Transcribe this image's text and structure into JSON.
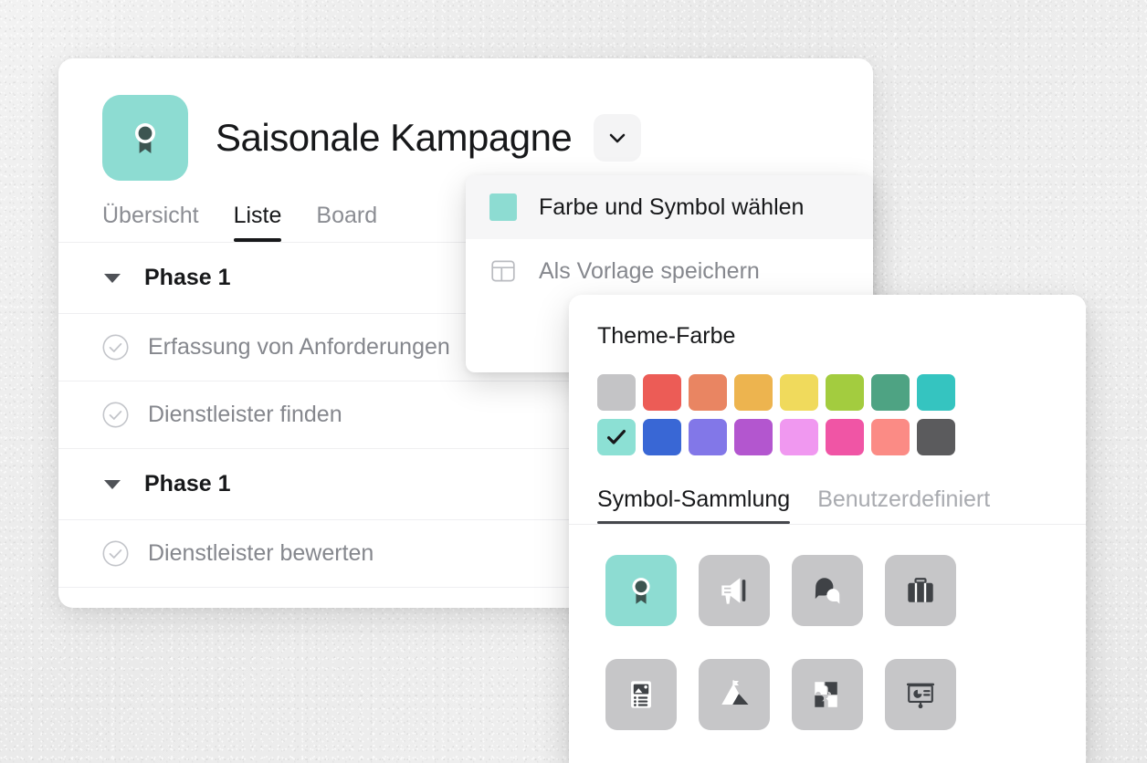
{
  "project": {
    "title": "Saisonale Kampagne",
    "icon": "award-ribbon-icon",
    "icon_color": "#8ddcd2",
    "caret_icon": "chevron-down-icon"
  },
  "tabs": [
    {
      "label": "Übersicht",
      "active": false
    },
    {
      "label": "Liste",
      "active": true
    },
    {
      "label": "Board",
      "active": false
    }
  ],
  "list": [
    {
      "type": "group",
      "label": "Phase 1",
      "caret": "caret-down-icon"
    },
    {
      "type": "task",
      "label": "Erfassung von Anforderungen",
      "check": "check-circle-icon"
    },
    {
      "type": "task",
      "label": "Dienstleister finden",
      "check": "check-circle-icon"
    },
    {
      "type": "group",
      "label": "Phase 1",
      "caret": "caret-down-icon"
    },
    {
      "type": "task",
      "label": "Dienstleister bewerten",
      "check": "check-circle-icon"
    }
  ],
  "context_menu": {
    "items": [
      {
        "label": "Farbe und Symbol wählen",
        "icon": "color-swatch-icon",
        "swatch_color": "#8ddcd2",
        "highlighted": true
      },
      {
        "label": "Als Vorlage speichern",
        "icon": "template-layout-icon",
        "highlighted": false
      }
    ]
  },
  "picker": {
    "theme_color_title": "Theme-Farbe",
    "colors": [
      {
        "hex": "#c4c4c6",
        "selected": false
      },
      {
        "hex": "#ec5c56",
        "selected": false
      },
      {
        "hex": "#e98562",
        "selected": false
      },
      {
        "hex": "#edb44f",
        "selected": false
      },
      {
        "hex": "#f0da5c",
        "selected": false
      },
      {
        "hex": "#a3cc3f",
        "selected": false
      },
      {
        "hex": "#4ea383",
        "selected": false
      },
      {
        "hex": "#35c4c0",
        "selected": false
      },
      {
        "hex": "#8ce0d4",
        "selected": true
      },
      {
        "hex": "#3967d5",
        "selected": false
      },
      {
        "hex": "#8277e8",
        "selected": false
      },
      {
        "hex": "#b356cf",
        "selected": false
      },
      {
        "hex": "#f098f0",
        "selected": false
      },
      {
        "hex": "#f055a5",
        "selected": false
      },
      {
        "hex": "#fb8b85",
        "selected": false
      },
      {
        "hex": "#5b5b5d",
        "selected": false
      }
    ],
    "selected_check_icon": "checkmark-icon",
    "tabs": [
      {
        "label": "Symbol-Sammlung",
        "active": true
      },
      {
        "label": "Benutzerdefiniert",
        "active": false
      }
    ],
    "icons": [
      {
        "name": "award-ribbon-icon",
        "selected": true
      },
      {
        "name": "megaphone-icon",
        "selected": false
      },
      {
        "name": "chat-bubbles-icon",
        "selected": false
      },
      {
        "name": "briefcase-icon",
        "selected": false
      },
      {
        "name": "article-image-icon",
        "selected": false
      },
      {
        "name": "mountain-flag-icon",
        "selected": false
      },
      {
        "name": "puzzle-pieces-icon",
        "selected": false
      },
      {
        "name": "presentation-board-icon",
        "selected": false
      }
    ]
  }
}
